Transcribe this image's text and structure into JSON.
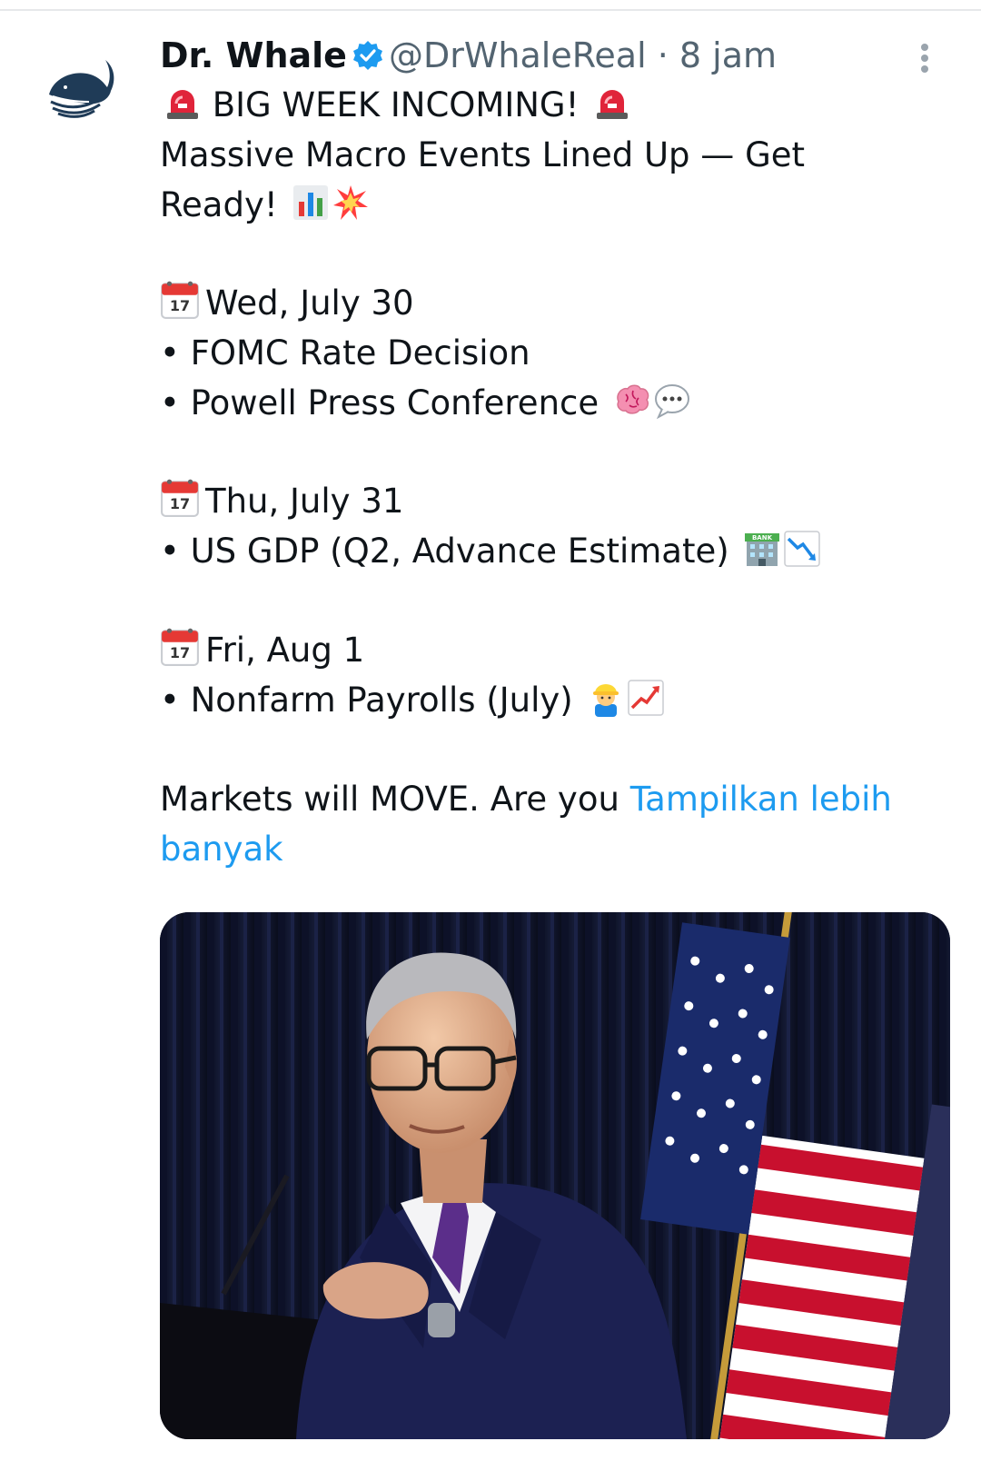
{
  "tweet": {
    "author_name": "Dr. Whale",
    "handle": "@DrWhaleReal",
    "separator": "·",
    "time": "8 jam",
    "line1": "BIG WEEK INCOMING!",
    "line2": "Massive Macro Events Lined Up — Get",
    "line3": "Ready!",
    "event1_date": "Wed, July 30",
    "event1_item1": "• FOMC Rate Decision",
    "event1_item2": "• Powell Press Conference",
    "event2_date": "Thu, July 31",
    "event2_item1": "• US GDP (Q2, Advance Estimate)",
    "event3_date": "Fri, Aug 1",
    "event3_item1": "• Nonfarm Payrolls (July)",
    "closing": "Markets will MOVE. Are you",
    "show_more_part1": "Tampilkan lebih",
    "show_more_part2": "banyak",
    "calendar_day": "17"
  },
  "icons": {
    "verified": "verified-badge-icon",
    "more": "more-options-icon",
    "siren": "police-light-icon",
    "calendar": "calendar-icon",
    "chart": "bar-chart-icon",
    "explosion": "collision-icon",
    "brain": "brain-icon",
    "speech": "speech-bubble-icon",
    "bank": "bank-icon",
    "chart_down": "chart-decreasing-icon",
    "worker": "construction-worker-icon",
    "chart_up": "chart-increasing-icon"
  },
  "colors": {
    "link": "#1d9bf0",
    "verified": "#1d9bf0",
    "muted": "#536471",
    "text": "#0f1419"
  }
}
